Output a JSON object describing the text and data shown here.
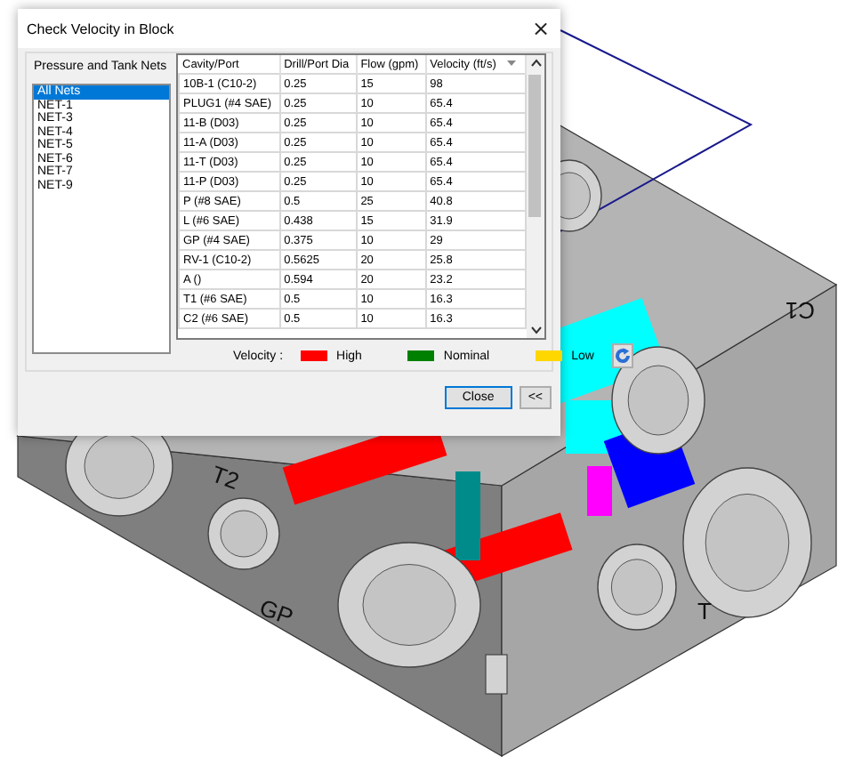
{
  "block": {
    "port_labels": [
      {
        "text": "T2",
        "kind": "left"
      },
      {
        "text": "GP",
        "kind": "left"
      },
      {
        "text": "T",
        "kind": "right"
      },
      {
        "text": "C1",
        "kind": "mirrored"
      }
    ]
  },
  "dialog": {
    "title": "Check Velocity in Block",
    "close": "×",
    "nets": {
      "title": "Pressure and Tank Nets",
      "items": [
        {
          "label": "All Nets",
          "selected": true
        },
        {
          "label": "NET-1",
          "selected": false
        },
        {
          "label": "NET-3",
          "selected": false
        },
        {
          "label": "NET-4",
          "selected": false
        },
        {
          "label": "NET-5",
          "selected": false
        },
        {
          "label": "NET-6",
          "selected": false
        },
        {
          "label": "NET-7",
          "selected": false
        },
        {
          "label": "NET-9",
          "selected": false
        }
      ]
    },
    "table": {
      "columns": [
        {
          "label": "Cavity/Port",
          "sorted": false
        },
        {
          "label": "Drill/Port Dia",
          "sorted": false
        },
        {
          "label": "Flow (gpm)",
          "sorted": false
        },
        {
          "label": "Velocity (ft/s)",
          "sorted": true
        }
      ],
      "rows": [
        [
          "10B-1  (C10-2)",
          "0.25",
          "15",
          "98"
        ],
        [
          "PLUG1  (#4 SAE)",
          "0.25",
          "10",
          "65.4"
        ],
        [
          "11-B  (D03)",
          "0.25",
          "10",
          "65.4"
        ],
        [
          "11-A  (D03)",
          "0.25",
          "10",
          "65.4"
        ],
        [
          "11-T  (D03)",
          "0.25",
          "10",
          "65.4"
        ],
        [
          "11-P  (D03)",
          "0.25",
          "10",
          "65.4"
        ],
        [
          "P  (#8 SAE)",
          "0.5",
          "25",
          "40.8"
        ],
        [
          "L  (#6 SAE)",
          "0.438",
          "15",
          "31.9"
        ],
        [
          "GP  (#4 SAE)",
          "0.375",
          "10",
          "29"
        ],
        [
          "RV-1  (C10-2)",
          "0.5625",
          "20",
          "25.8"
        ],
        [
          "A  ()",
          "0.594",
          "20",
          "23.2"
        ],
        [
          "T1  (#6 SAE)",
          "0.5",
          "10",
          "16.3"
        ],
        [
          "C2  (#6 SAE)",
          "0.5",
          "10",
          "16.3"
        ]
      ]
    },
    "legend": {
      "label": "Velocity :",
      "items": [
        {
          "label": "High",
          "color": "#ff0000"
        },
        {
          "label": "Nominal",
          "color": "#008000"
        },
        {
          "label": "Low",
          "color": "#ffd700"
        }
      ]
    },
    "buttons": [
      {
        "label": "Close",
        "default": true
      },
      {
        "label": "<<",
        "default": false
      }
    ]
  }
}
